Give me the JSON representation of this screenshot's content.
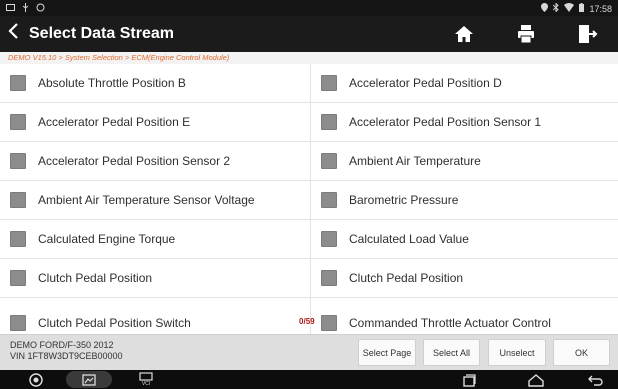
{
  "status": {
    "time": "17:58"
  },
  "header": {
    "title": "Select Data Stream",
    "icons": [
      "back-arrow-icon",
      "home-icon",
      "print-icon",
      "exit-icon"
    ]
  },
  "breadcrumb": "DEMO V15.10 > System Selection > ECM(Engine Control Module)",
  "items": [
    {
      "label": "Absolute Throttle Position B",
      "checked": false
    },
    {
      "label": "Accelerator Pedal Position D",
      "checked": false
    },
    {
      "label": "Accelerator Pedal Position E",
      "checked": false
    },
    {
      "label": "Accelerator Pedal Position Sensor 1",
      "checked": false
    },
    {
      "label": "Accelerator Pedal Position Sensor 2",
      "checked": false
    },
    {
      "label": "Ambient Air Temperature",
      "checked": false
    },
    {
      "label": "Ambient Air Temperature Sensor Voltage",
      "checked": false
    },
    {
      "label": "Barometric Pressure",
      "checked": false
    },
    {
      "label": "Calculated Engine Torque",
      "checked": false
    },
    {
      "label": "Calculated Load Value",
      "checked": false
    },
    {
      "label": "Clutch Pedal Position",
      "checked": false
    },
    {
      "label": "Clutch Pedal Position",
      "checked": false
    },
    {
      "label": "Clutch Pedal Position Switch",
      "checked": false
    },
    {
      "label": "Commanded Throttle Actuator Control",
      "checked": false
    }
  ],
  "counter": {
    "selected": "0",
    "total": "59"
  },
  "vehicle": {
    "line1": "DEMO FORD/F-350 2012",
    "line2": "VIN 1FT8W3DT9CEB00000"
  },
  "buttons": {
    "select_page": "Select Page",
    "select_all": "Select All",
    "unselect": "Unselect",
    "ok": "OK"
  },
  "navbar": {
    "vci_label": "VCI"
  },
  "colors": {
    "checkbox": "#8c8c8c",
    "breadcrumb": "#e06a2d",
    "counter": "#b01818"
  }
}
